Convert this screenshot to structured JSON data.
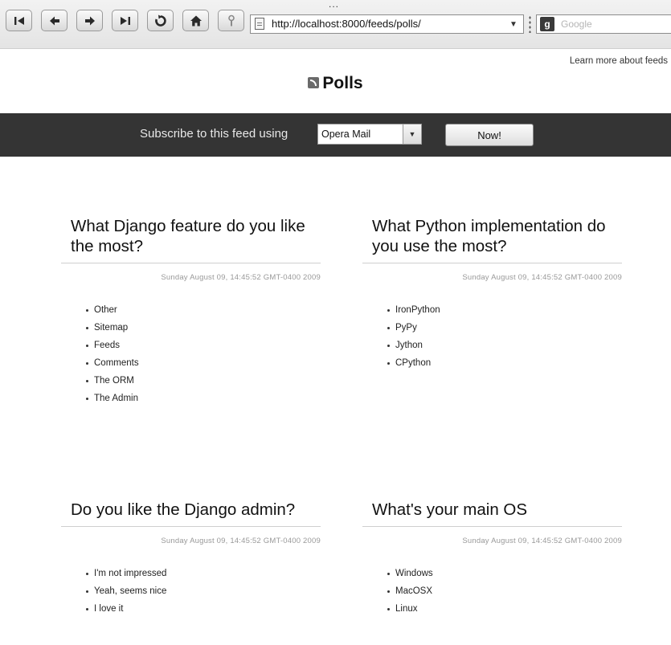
{
  "browser": {
    "menu_dots": "...",
    "url": "http://localhost:8000/feeds/polls/",
    "search_placeholder": "Google",
    "nav_buttons": [
      "rewind",
      "back",
      "forward",
      "fast-forward",
      "reload",
      "home",
      "wand"
    ]
  },
  "page": {
    "learn_more_link": "Learn more about feeds",
    "feed_title": "Polls",
    "subscribe_label": "Subscribe to this feed using",
    "reader_selected": "Opera Mail",
    "now_button": "Now!"
  },
  "polls": [
    {
      "question": "What Django feature do you like the most?",
      "date": "Sunday August 09, 14:45:52 GMT-0400 2009",
      "choices": [
        "Other",
        "Sitemap",
        "Feeds",
        "Comments",
        "The ORM",
        "The Admin"
      ]
    },
    {
      "question": "What Python implementation do you use the most?",
      "date": "Sunday August 09, 14:45:52 GMT-0400 2009",
      "choices": [
        "IronPython",
        "PyPy",
        "Jython",
        "CPython"
      ]
    },
    {
      "question": "Do you like the Django admin?",
      "date": "Sunday August 09, 14:45:52 GMT-0400 2009",
      "choices": [
        "I'm not impressed",
        "Yeah, seems nice",
        "I love it"
      ]
    },
    {
      "question": "What's your main OS",
      "date": "Sunday August 09, 14:45:52 GMT-0400 2009",
      "choices": [
        "Windows",
        "MacOSX",
        "Linux"
      ]
    }
  ]
}
